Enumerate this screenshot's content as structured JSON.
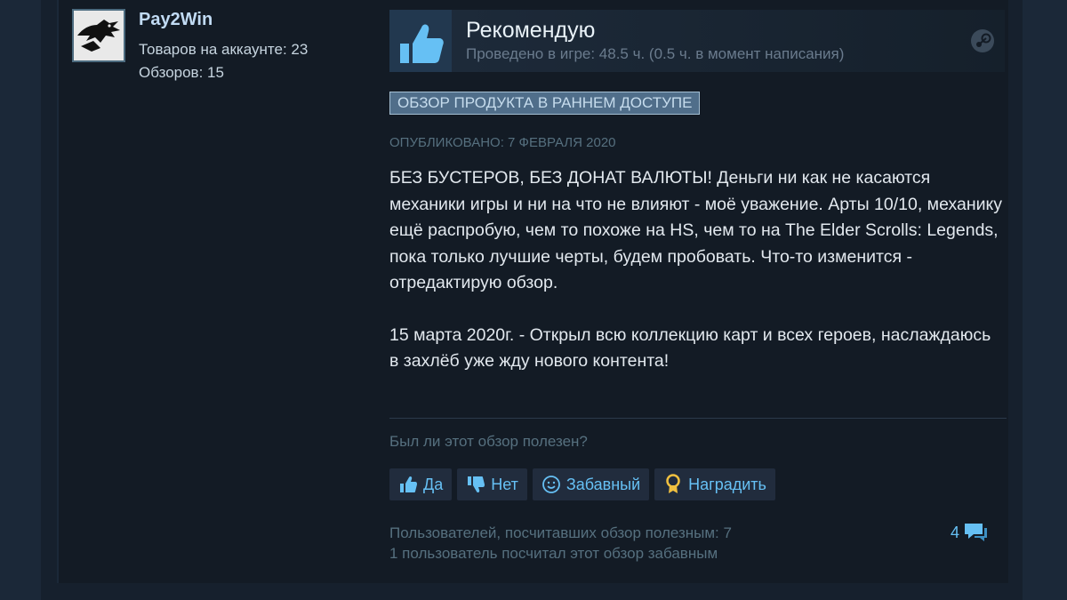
{
  "author": {
    "name": "Pay2Win",
    "products": "Товаров на аккаунте: 23",
    "reviews": "Обзоров: 15"
  },
  "review": {
    "verdict": "Рекомендую",
    "playtime": "Проведено в игре: 48.5 ч. (0.5 ч. в момент написания)",
    "early_access_badge": "ОБЗОР ПРОДУКТА В РАННЕМ ДОСТУПЕ",
    "posted": "ОПУБЛИКОВАНО: 7 ФЕВРАЛЯ 2020",
    "paragraph1": "БЕЗ БУСТЕРОВ, БЕЗ ДОНАТ ВАЛЮТЫ! Деньги ни как не касаются механики игры и ни на что не влияют - моё уважение. Арты 10/10, механику ещё распробую, чем то похоже на HS, чем то на The Elder Scrolls: Legends, пока только лучшие черты, будем пробовать. Что-то изменится - отредактирую обзор.",
    "paragraph2": "15 марта 2020г. - Открыл всю коллекцию карт и всех героев, наслаждаюсь в захлёб уже жду нового контента!"
  },
  "feedback": {
    "question": "Был ли этот обзор полезен?",
    "yes": "Да",
    "no": "Нет",
    "funny": "Забавный",
    "award": "Наградить",
    "helpful_count_text": "Пользователей, посчитавших обзор полезным: 7",
    "funny_count_text": "1 пользователь посчитал этот обзор забавным",
    "comments_count": "4"
  },
  "colors": {
    "accent": "#66c0f4",
    "background": "#131b25",
    "text": "#c6d4df"
  }
}
